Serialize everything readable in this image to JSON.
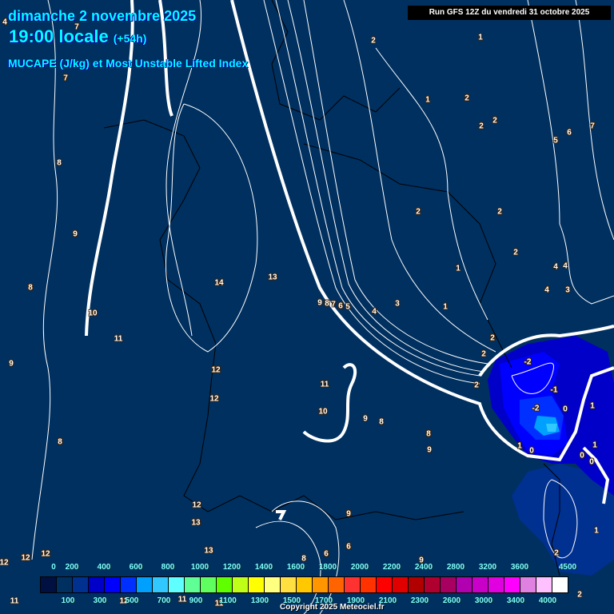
{
  "header": {
    "date": "dimanche 2 novembre 2025",
    "time": "19:00 locale",
    "lead": "(+54h)",
    "variable": "MUCAPE (J/kg) et Most Unstable Lifted Index",
    "run": "Run GFS 12Z du vendredi 31 octobre 2025"
  },
  "map": {
    "background_color": "#003060",
    "contour_labels": [
      "4",
      "7",
      "7",
      "8",
      "9",
      "8",
      "10",
      "11",
      "9",
      "14",
      "13",
      "12",
      "12",
      "11",
      "10",
      "8",
      "9",
      "8",
      "8",
      "9",
      "9",
      "8",
      "7",
      "6",
      "5",
      "4",
      "3",
      "1",
      "1",
      "2",
      "2",
      "2",
      "2",
      "2",
      "2",
      "-2",
      "-1",
      "-2",
      "0",
      "1",
      "0",
      "1",
      "0",
      "0",
      "1",
      "2",
      "1",
      "1",
      "2",
      "2",
      "2",
      "6",
      "7",
      "5",
      "4",
      "4",
      "3",
      "4",
      "12",
      "13",
      "13",
      "9",
      "6",
      "6",
      "8",
      "9",
      "2",
      "1",
      "12",
      "12",
      "12",
      "11",
      "12",
      "11",
      "11",
      "2"
    ]
  },
  "colorbar": {
    "colors": [
      "#001040",
      "#003060",
      "#003090",
      "#0000c8",
      "#0000ff",
      "#0030ff",
      "#00a0ff",
      "#30c8ff",
      "#60ffff",
      "#60ff96",
      "#60ff60",
      "#60ff00",
      "#c0ff18",
      "#ffff00",
      "#ffff80",
      "#ffe040",
      "#ffc800",
      "#ff9600",
      "#ff6400",
      "#ff3232",
      "#ff3200",
      "#ff0000",
      "#e00000",
      "#b00000",
      "#b00030",
      "#a80060",
      "#b000b0",
      "#c800c8",
      "#e000e0",
      "#ff00ff",
      "#e080e0",
      "#ffc0ff",
      "#ffffff"
    ],
    "top_labels": [
      "0",
      "200",
      "400",
      "600",
      "800",
      "1000",
      "1200",
      "1400",
      "1600",
      "1800",
      "2000",
      "2200",
      "2400",
      "2800",
      "3200",
      "3600",
      "4500"
    ],
    "bottom_labels": [
      "100",
      "300",
      "500",
      "700",
      "900",
      "1100",
      "1300",
      "1500",
      "1700",
      "1900",
      "2100",
      "2300",
      "2600",
      "3000",
      "3400",
      "4000"
    ]
  },
  "footer": {
    "copyright": "Copyright 2025 Meteociel.fr"
  }
}
